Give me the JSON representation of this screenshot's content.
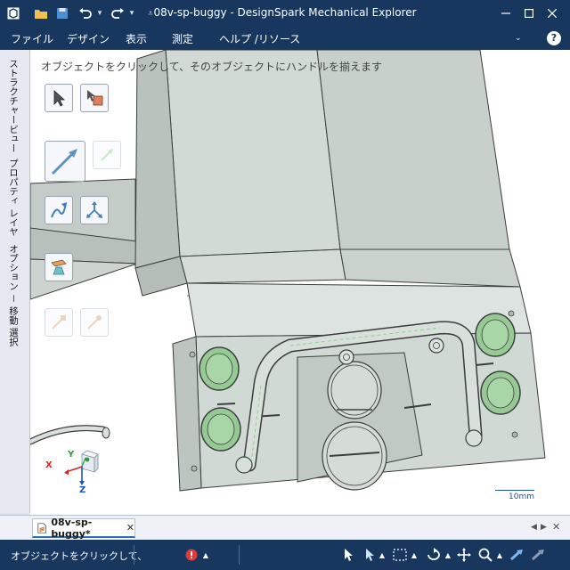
{
  "window": {
    "title": "08v-sp-buggy - DesignSpark Mechanical Explorer"
  },
  "menu": {
    "items": [
      "ファイル",
      "デザイン",
      "表示",
      "測定",
      "ヘルプ /リソース"
    ]
  },
  "side_tabs": [
    "ストラクチャー",
    "ビュー",
    "プロパティ",
    "レイヤ",
    "オプション － 移動",
    "選択"
  ],
  "viewport": {
    "hint": "オブジェクトをクリックして、そのオブジェクトにハンドルを揃えます",
    "scale_label": "10mm",
    "axes": {
      "x": "X",
      "y": "Y",
      "z": "Z"
    }
  },
  "document_tab": {
    "label": "08v-sp-buggy*",
    "close": "✕"
  },
  "status": {
    "text": "オブジェクトをクリックして、"
  },
  "colors": {
    "chrome": "#17375e",
    "model_face": "#d1d9d5",
    "model_edge": "#3a3f3c",
    "hole_green": "#96c994",
    "scale_blue": "#1f4fb0"
  }
}
